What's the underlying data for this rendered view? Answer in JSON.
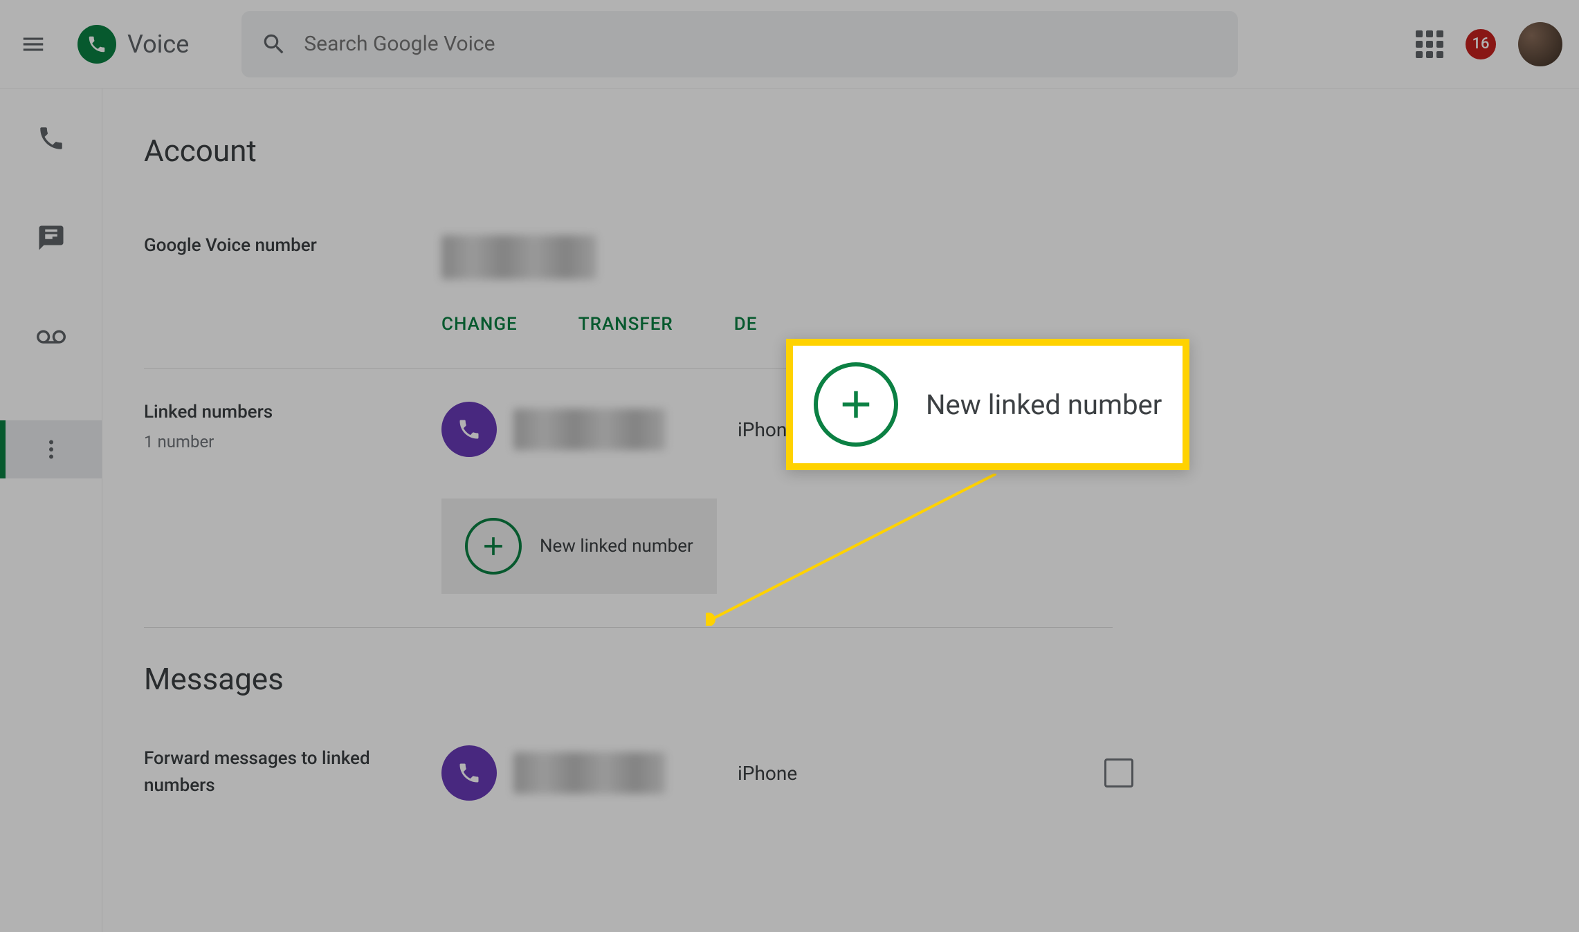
{
  "header": {
    "logo_text": "Voice",
    "search_placeholder": "Search Google Voice",
    "notif_count": "16"
  },
  "section_account": {
    "title": "Account",
    "gv_number_label": "Google Voice number",
    "actions": {
      "change": "CHANGE",
      "transfer": "TRANSFER",
      "delete": "DE"
    },
    "linked_label": "Linked numbers",
    "linked_sub": "1 number",
    "linked_item": {
      "device": "iPhone"
    },
    "new_linked_label": "New linked number"
  },
  "section_messages": {
    "title": "Messages",
    "forward_label": "Forward messages to linked numbers",
    "forward_item": {
      "device": "iPhone"
    }
  },
  "callout": {
    "text": "New linked number"
  }
}
